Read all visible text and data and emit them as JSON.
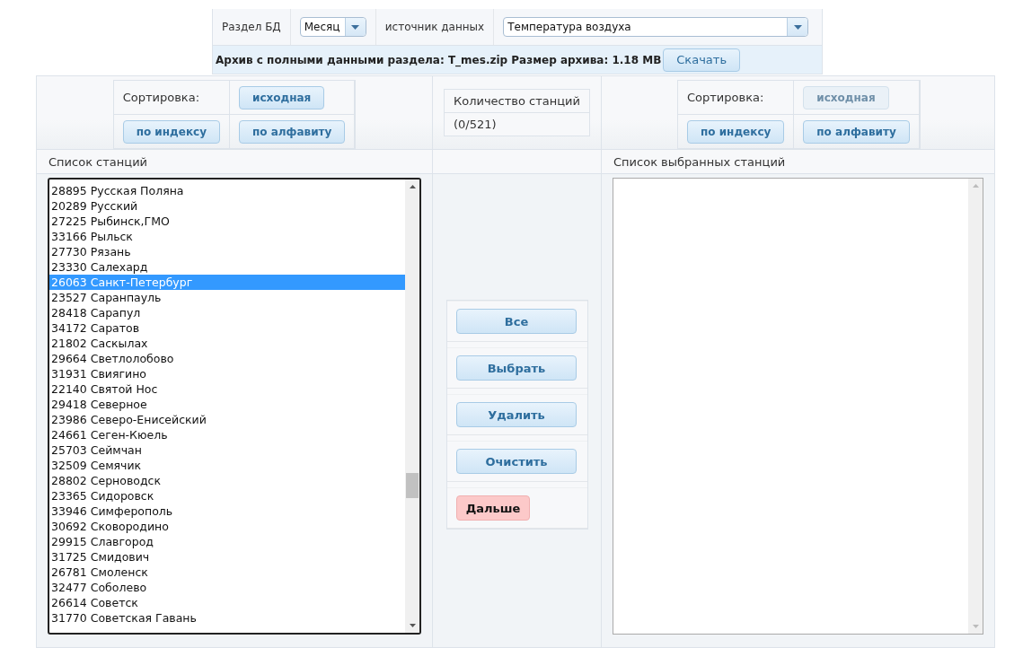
{
  "top_panel": {
    "section_label": "Раздел БД",
    "section_select": {
      "value": "Месяц"
    },
    "source_label": "источник данных",
    "source_select": {
      "value": "Температура воздуха"
    },
    "archive_text": "Архив с полными данными раздела: T_mes.zip Размер архива: 1.18 MB",
    "download_button": "Скачать"
  },
  "left_sort": {
    "label": "Сортировка:",
    "buttons": [
      {
        "label": "исходная",
        "disabled": false
      },
      {
        "label": "по индексу",
        "disabled": false
      },
      {
        "label": "по алфавиту",
        "disabled": false
      }
    ]
  },
  "station_count": {
    "label": "Количество станций",
    "value": "(0/521)"
  },
  "right_sort": {
    "label": "Сортировка:",
    "buttons": [
      {
        "label": "исходная",
        "disabled": true
      },
      {
        "label": "по индексу",
        "disabled": false
      },
      {
        "label": "по алфавиту",
        "disabled": false
      }
    ]
  },
  "station_list": {
    "title": "Список станций",
    "items": [
      {
        "text": "28895 Русская Поляна",
        "selected": false
      },
      {
        "text": "20289 Русский",
        "selected": false
      },
      {
        "text": "27225 Рыбинск,ГМО",
        "selected": false
      },
      {
        "text": "33166 Рыльск",
        "selected": false
      },
      {
        "text": "27730 Рязань",
        "selected": false
      },
      {
        "text": "23330 Салехард",
        "selected": false
      },
      {
        "text": "26063 Санкт-Петербург",
        "selected": true
      },
      {
        "text": "23527 Саранпауль",
        "selected": false
      },
      {
        "text": "28418 Сарапул",
        "selected": false
      },
      {
        "text": "34172 Саратов",
        "selected": false
      },
      {
        "text": "21802 Саскылах",
        "selected": false
      },
      {
        "text": "29664 Светлолобово",
        "selected": false
      },
      {
        "text": "31931 Свиягино",
        "selected": false
      },
      {
        "text": "22140 Святой Нос",
        "selected": false
      },
      {
        "text": "29418 Северное",
        "selected": false
      },
      {
        "text": "23986 Северо-Енисейский",
        "selected": false
      },
      {
        "text": "24661 Сеген-Кюель",
        "selected": false
      },
      {
        "text": "25703 Сеймчан",
        "selected": false
      },
      {
        "text": "32509 Семячик",
        "selected": false
      },
      {
        "text": "28802 Серноводск",
        "selected": false
      },
      {
        "text": "23365 Сидоровск",
        "selected": false
      },
      {
        "text": "33946 Симферополь",
        "selected": false
      },
      {
        "text": "30692 Сковородино",
        "selected": false
      },
      {
        "text": "29915 Славгород",
        "selected": false
      },
      {
        "text": "31725 Смидович",
        "selected": false
      },
      {
        "text": "26781 Смоленск",
        "selected": false
      },
      {
        "text": "32477 Соболево",
        "selected": false
      },
      {
        "text": "26614 Советск",
        "selected": false
      },
      {
        "text": "31770 Советская Гавань",
        "selected": false
      }
    ]
  },
  "actions": [
    {
      "label": "Все",
      "kind": "normal"
    },
    {
      "label": "Выбрать",
      "kind": "normal"
    },
    {
      "label": "Удалить",
      "kind": "normal"
    },
    {
      "label": "Очистить",
      "kind": "normal"
    },
    {
      "label": "Дальше",
      "kind": "primary"
    }
  ],
  "selected_list": {
    "title": "Список выбранных станций"
  }
}
